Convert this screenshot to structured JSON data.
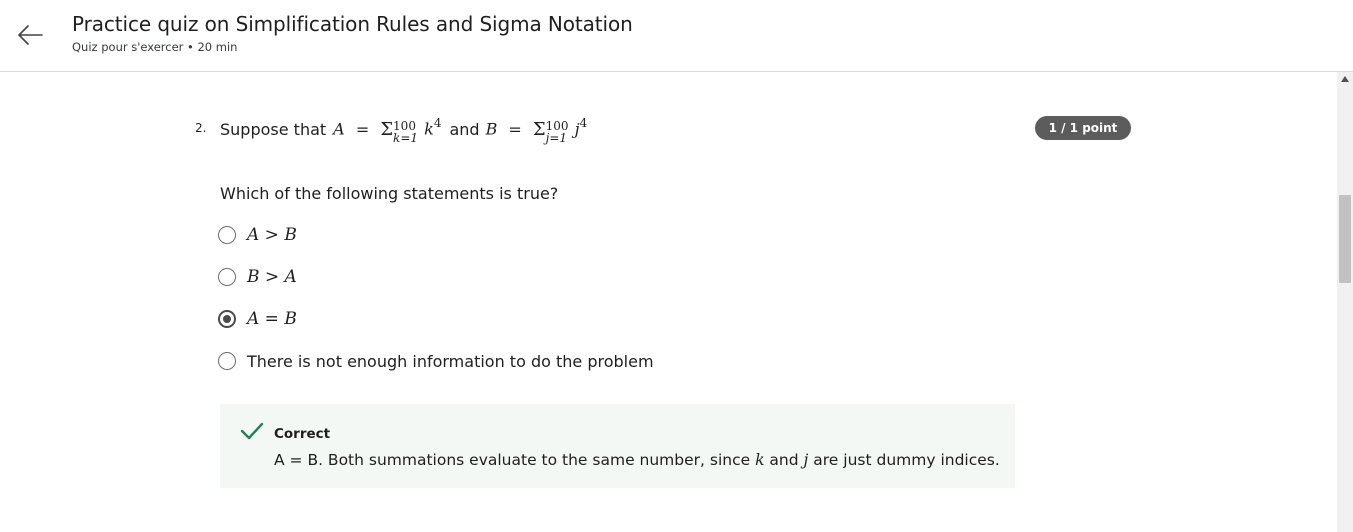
{
  "header": {
    "title": "Practice quiz on Simplification Rules and Sigma Notation",
    "subtitle": "Quiz pour s'exercer • 20 min",
    "back_icon": "arrow-left-icon"
  },
  "question": {
    "number": "2.",
    "intro": "Suppose that",
    "a_var": "A",
    "eq": "=",
    "sigma": "Σ",
    "upper": "100",
    "lower_a": "k=1",
    "term_a": "k",
    "power": "4",
    "conj": "and",
    "b_var": "B",
    "lower_b": "j=1",
    "term_b": "j",
    "score": "1 / 1 point",
    "prompt": "Which of the following statements is true?",
    "options": [
      {
        "label": "A > B",
        "selected": false
      },
      {
        "label": "B > A",
        "selected": false
      },
      {
        "label": "A = B",
        "selected": true
      },
      {
        "label": "There is not enough information to do the problem",
        "selected": false
      }
    ]
  },
  "feedback": {
    "title": "Correct",
    "text_1": "A = B. Both summations evaluate to the same number, since",
    "var_k": "k",
    "and": "and",
    "var_j": "j",
    "text_2": "are just dummy indices.",
    "icon": "checkmark-icon",
    "accent": "#1f8354",
    "background": "#f3f8f5"
  },
  "colors": {
    "badge": "#5c5c5c",
    "radio": "#6f6f6f"
  }
}
